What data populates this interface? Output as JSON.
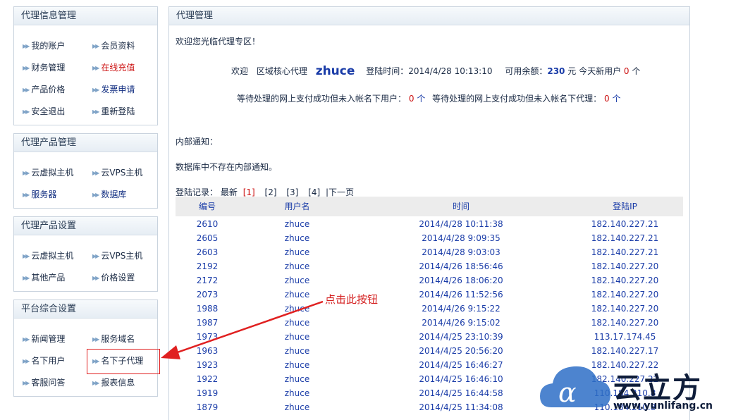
{
  "sidebar": {
    "agent_info": {
      "title": "代理信息管理",
      "items": [
        {
          "label": "我的账户"
        },
        {
          "label": "会员资料"
        },
        {
          "label": "财务管理"
        },
        {
          "label": "在线充值"
        },
        {
          "label": "产品价格"
        },
        {
          "label": "发票申请"
        },
        {
          "label": "安全退出"
        },
        {
          "label": "重新登陆"
        }
      ]
    },
    "agent_products": {
      "title": "代理产品管理",
      "items": [
        {
          "label": "云虚拟主机"
        },
        {
          "label": "云VPS主机"
        },
        {
          "label": "服务器"
        },
        {
          "label": "数据库"
        }
      ]
    },
    "product_settings": {
      "title": "代理产品设置",
      "items": [
        {
          "label": "云虚拟主机"
        },
        {
          "label": "云VPS主机"
        },
        {
          "label": "其他产品"
        },
        {
          "label": "价格设置"
        }
      ]
    },
    "platform": {
      "title": "平台综合设置",
      "items": [
        {
          "label": "新闻管理"
        },
        {
          "label": "服务域名"
        },
        {
          "label": "名下用户"
        },
        {
          "label": "名下子代理"
        },
        {
          "label": "客服问答"
        },
        {
          "label": "报表信息"
        }
      ]
    }
  },
  "main": {
    "title": "代理管理",
    "welcome": "欢迎您光临代理专区！",
    "greeting": "欢迎",
    "agent_level": "区域核心代理",
    "username": "zhuce",
    "login_time_label": "登陆时间：",
    "login_time": "2014/4/28 10:13:10",
    "balance_label": "可用余额：",
    "balance_value": "230",
    "balance_unit": "元",
    "new_users_label": "今天新用户",
    "new_users_count": "0",
    "count_unit": "个",
    "pending_users_label": "等待处理的网上支付成功但未入帐名下用户：",
    "pending_users_count": "0",
    "pending_agents_label": "等待处理的网上支付成功但未入帐名下代理：",
    "pending_agents_count": "0",
    "notice_label": "内部通知：",
    "notice_empty": "数据库中不存在内部通知。",
    "login_records_label": "登陆记录：",
    "pager": {
      "latest": "最新",
      "current": "[1]",
      "pages": [
        "[2]",
        "[3]",
        "[4]"
      ],
      "next": "|下一页"
    },
    "table": {
      "headers": [
        "编号",
        "用户名",
        "时间",
        "登陆IP"
      ],
      "rows": [
        [
          "2610",
          "zhuce",
          "2014/4/28 10:11:38",
          "182.140.227.21"
        ],
        [
          "2605",
          "zhuce",
          "2014/4/28 9:09:35",
          "182.140.227.21"
        ],
        [
          "2603",
          "zhuce",
          "2014/4/28 9:03:03",
          "182.140.227.21"
        ],
        [
          "2192",
          "zhuce",
          "2014/4/26 18:56:46",
          "182.140.227.20"
        ],
        [
          "2172",
          "zhuce",
          "2014/4/26 18:06:20",
          "182.140.227.20"
        ],
        [
          "2073",
          "zhuce",
          "2014/4/26 11:52:56",
          "182.140.227.20"
        ],
        [
          "1988",
          "zhuce",
          "2014/4/26 9:15:22",
          "182.140.227.20"
        ],
        [
          "1987",
          "zhuce",
          "2014/4/26 9:15:02",
          "182.140.227.20"
        ],
        [
          "1973",
          "zhuce",
          "2014/4/25 23:10:39",
          "113.17.174.45"
        ],
        [
          "1963",
          "zhuce",
          "2014/4/25 20:56:20",
          "182.140.227.17"
        ],
        [
          "1923",
          "zhuce",
          "2014/4/25 16:46:27",
          "182.140.227.22"
        ],
        [
          "1922",
          "zhuce",
          "2014/4/25 16:46:10",
          "182.140.227.22"
        ],
        [
          "1919",
          "zhuce",
          "2014/4/25 16:44:58",
          "110.184.210.8"
        ],
        [
          "1879",
          "zhuce",
          "2014/4/25 11:34:08",
          "110.184.210.8"
        ]
      ]
    }
  },
  "annotation": {
    "callout": "点击此按钮"
  },
  "watermark": {
    "brand": "云立方",
    "url": "www.yunlifang.cn"
  },
  "colors": {
    "accent_red": "#cc1111",
    "link_blue": "#1a3ca8",
    "panel_border": "#c9d3de"
  },
  "icons": {
    "menu_bullet": "double-arrow-icon",
    "callout_arrow": "red-arrow-icon",
    "watermark_logo": "cloud-alpha-logo-icon"
  }
}
